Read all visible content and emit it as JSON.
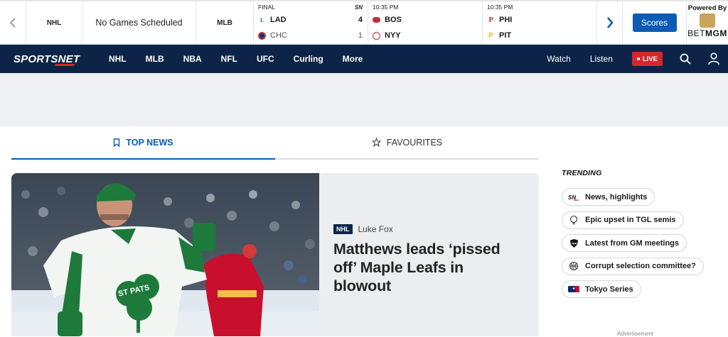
{
  "scorebar": {
    "league_nhl": "NHL",
    "no_games": "No Games Scheduled",
    "league_mlb": "MLB",
    "games": [
      {
        "status": "FINAL",
        "network": "SN",
        "teams": [
          {
            "abbr": "LAD",
            "score": "4",
            "winner": true,
            "color": "#1e5cb3"
          },
          {
            "abbr": "CHC",
            "score": "1",
            "winner": false,
            "color": "#0e3386"
          }
        ]
      },
      {
        "status": "10:35 PM",
        "network": "",
        "teams": [
          {
            "abbr": "BOS",
            "score": "",
            "winner": true,
            "color": "#bd3039"
          },
          {
            "abbr": "NYY",
            "score": "",
            "winner": true,
            "color": "#132448"
          }
        ]
      },
      {
        "status": "10:35 PM",
        "network": "",
        "teams": [
          {
            "abbr": "PHI",
            "score": "",
            "winner": true,
            "color": "#e81828"
          },
          {
            "abbr": "PIT",
            "score": "",
            "winner": true,
            "color": "#fdb827"
          }
        ]
      }
    ],
    "scores_button": "Scores",
    "powered_by": "Powered By",
    "sponsor_prefix": "BET",
    "sponsor_suffix": "MGM"
  },
  "nav": {
    "brand": "SPORTSNET",
    "links": [
      "NHL",
      "MLB",
      "NBA",
      "NFL",
      "UFC",
      "Curling",
      "More"
    ],
    "watch": "Watch",
    "listen": "Listen",
    "live": "LIVE"
  },
  "tabs": [
    {
      "label": "TOP NEWS",
      "icon": "bookmark-icon",
      "active": true
    },
    {
      "label": "FAVOURITES",
      "icon": "star-icon",
      "active": false
    }
  ],
  "hero": {
    "badge": "NHL",
    "author": "Luke Fox",
    "headline": "Matthews leads ‘pissed off’ Maple Leafs in blowout",
    "jersey_text": "ST PATS"
  },
  "trending": {
    "title": "TRENDING",
    "items": [
      {
        "label": "News, highlights",
        "icon": "sn-logo-icon"
      },
      {
        "label": "Epic upset in TGL semis",
        "icon": "golf-ball-icon"
      },
      {
        "label": "Latest from GM meetings",
        "icon": "nhl-shield-icon"
      },
      {
        "label": "Corrupt selection committee?",
        "icon": "basketball-icon"
      },
      {
        "label": "Tokyo Series",
        "icon": "mlb-logo-icon"
      }
    ]
  },
  "advertisement": "Advertisement",
  "colors": {
    "navy": "#0d2448",
    "accent": "#0c5bb5",
    "live": "#d6262e"
  }
}
